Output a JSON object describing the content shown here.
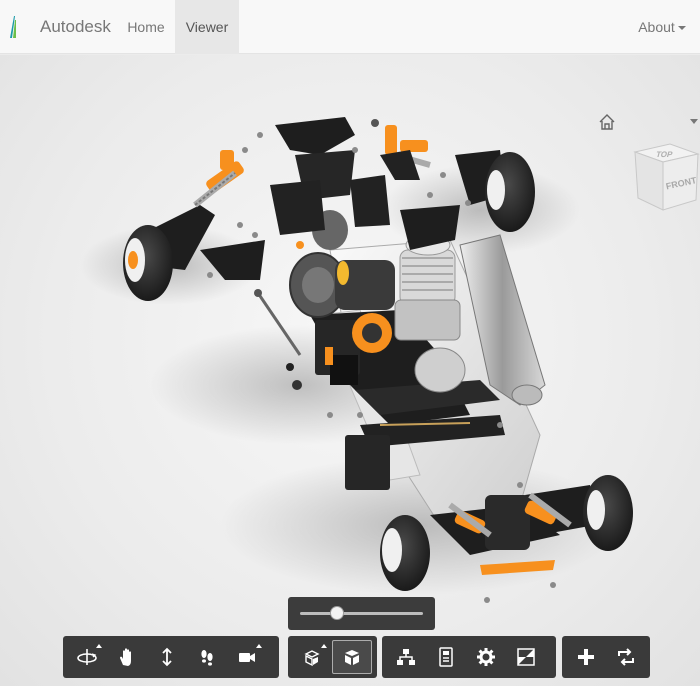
{
  "navbar": {
    "brand": "Autodesk",
    "items": [
      {
        "label": "Home",
        "active": false
      },
      {
        "label": "Viewer",
        "active": true
      }
    ],
    "about_label": "About"
  },
  "viewcube": {
    "top_label": "TOP",
    "front_label": "FRONT"
  },
  "explode_slider": {
    "value": 0.3
  },
  "toolbar": {
    "navigation": [
      "orbit-icon",
      "pan-icon",
      "zoom-icon",
      "first-person-icon",
      "camera-icon"
    ],
    "explode_tools": [
      "explode-icon",
      "model-box-icon"
    ],
    "model_tools": [
      "structure-icon",
      "properties-icon",
      "settings-icon",
      "fullscreen-icon"
    ],
    "extensions": [
      "add-icon",
      "refresh-icon"
    ]
  },
  "colors": {
    "accent": "#f7901e",
    "chassis": "#1e1e1e",
    "toolbar": "#353535"
  }
}
